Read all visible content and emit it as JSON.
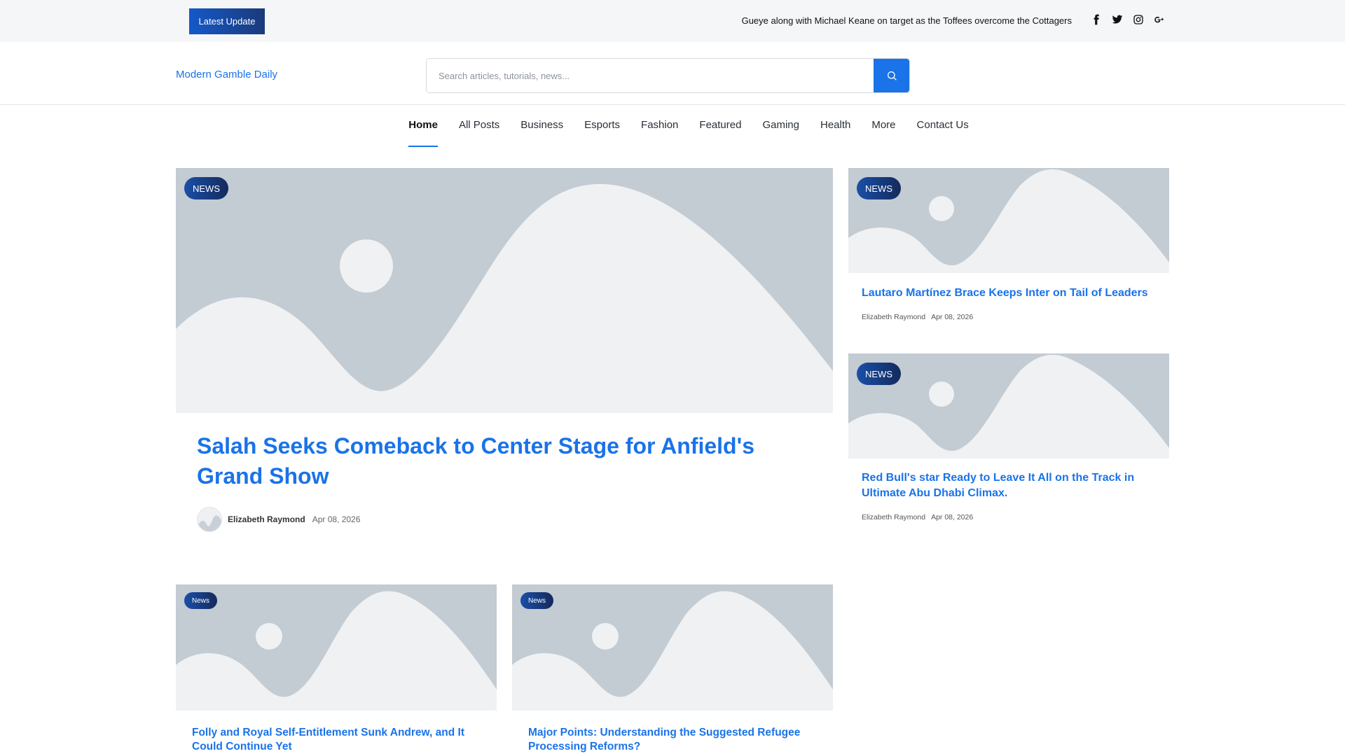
{
  "topbar": {
    "latest_label": "Latest Update",
    "ticker": "Gueye along with Michael Keane on target as the Toffees overcome the Cottagers",
    "social": [
      "facebook-icon",
      "twitter-icon",
      "instagram-icon",
      "google-plus-icon"
    ]
  },
  "header": {
    "logo": "Modern Gamble Daily",
    "search_placeholder": "Search articles, tutorials, news..."
  },
  "nav": {
    "items": [
      "Home",
      "All Posts",
      "Business",
      "Esports",
      "Fashion",
      "Featured",
      "Gaming",
      "Health",
      "More",
      "Contact Us"
    ],
    "active": "Home"
  },
  "hero": {
    "badge": "NEWS",
    "title": "Salah Seeks Comeback to Center Stage for Anfield's Grand Show",
    "author": "Elizabeth Raymond",
    "date": "Apr 08, 2026"
  },
  "side_posts": [
    {
      "badge": "NEWS",
      "title": "Lautaro Martínez Brace Keeps Inter on Tail of Leaders",
      "author": "Elizabeth Raymond",
      "date": "Apr 08, 2026"
    },
    {
      "badge": "NEWS",
      "title": "Red Bull's star Ready to Leave It All on the Track in Ultimate Abu Dhabi Climax.",
      "author": "Elizabeth Raymond",
      "date": "Apr 08, 2026"
    }
  ],
  "grid_posts": [
    {
      "badge": "News",
      "title": "Folly and Royal Self-Entitlement Sunk Andrew, and It Could Continue Yet"
    },
    {
      "badge": "News",
      "title": "Major Points: Understanding the Suggested Refugee Processing Reforms?"
    }
  ],
  "colors": {
    "accent": "#1a73e8",
    "badge_dark": "#142a5c",
    "placeholder_bg": "#c3cbd3",
    "placeholder_fg": "#eff1f3"
  }
}
